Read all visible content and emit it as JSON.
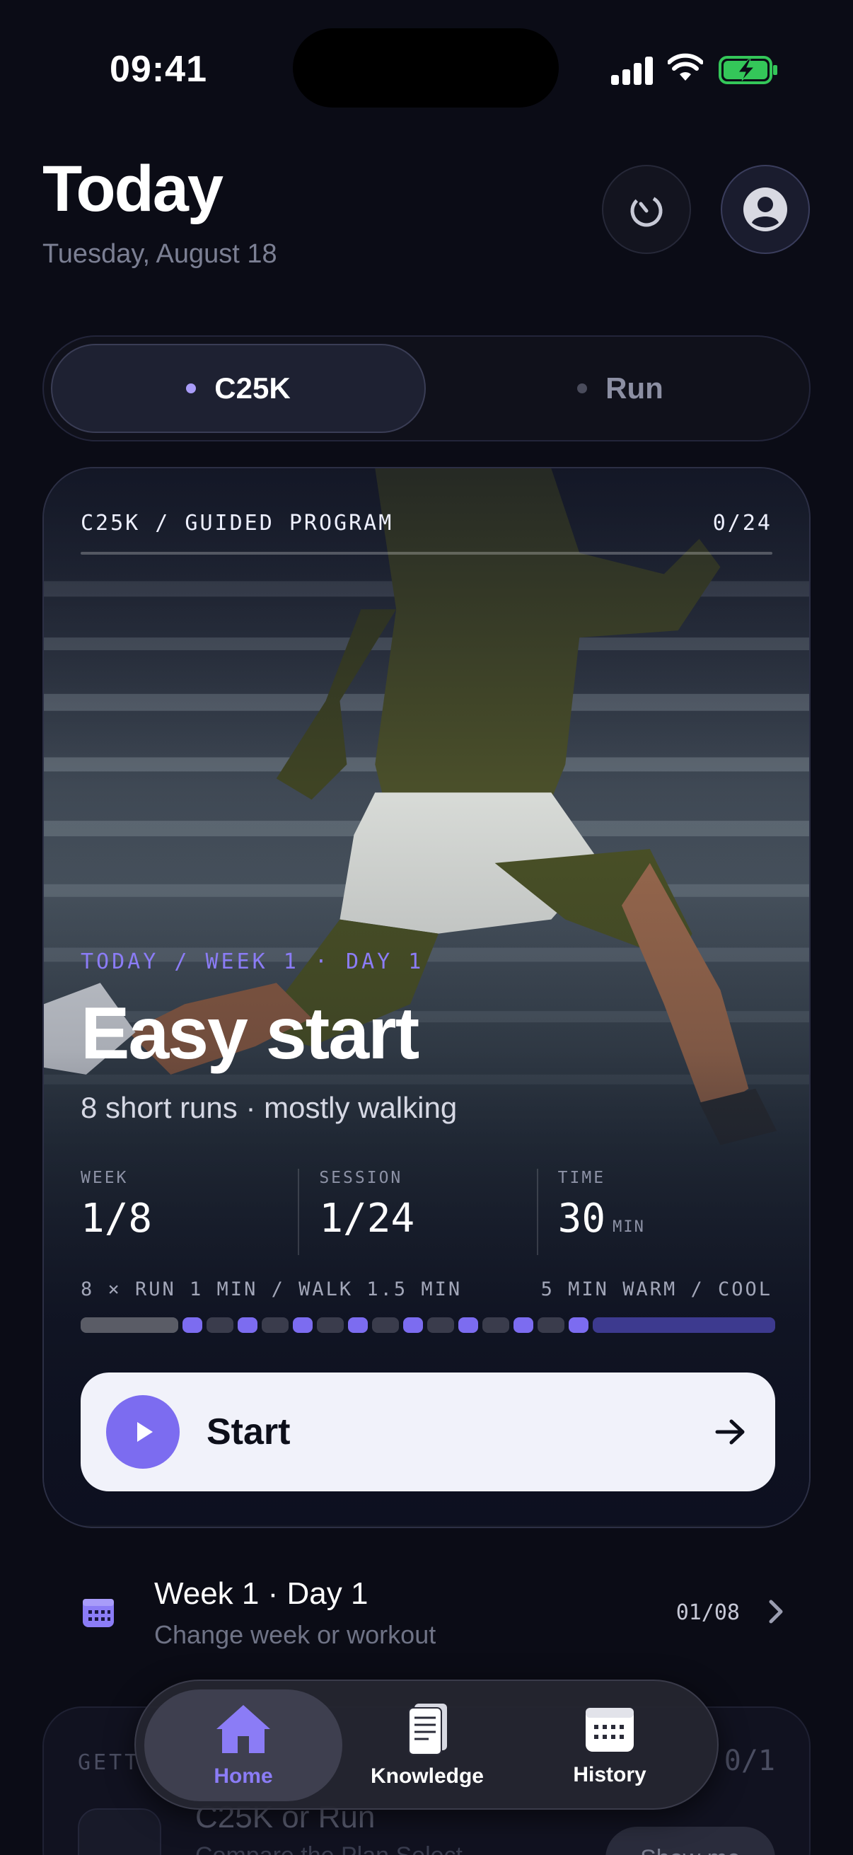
{
  "status_bar": {
    "time": "09:41"
  },
  "header": {
    "title": "Today",
    "date": "Tuesday, August 18"
  },
  "segment": {
    "tabs": [
      "C25K",
      "Run"
    ],
    "selected": "C25K"
  },
  "hero": {
    "program_label": "C25K / GUIDED PROGRAM",
    "progress_count": "0/24",
    "eyebrow": "TODAY / WEEK 1 · DAY 1",
    "title": "Easy start",
    "subtitle": "8 short runs · mostly walking",
    "stats": [
      {
        "label": "WEEK",
        "value": "1/8",
        "unit": ""
      },
      {
        "label": "SESSION",
        "value": "1/24",
        "unit": ""
      },
      {
        "label": "TIME",
        "value": "30",
        "unit": "MIN"
      }
    ],
    "interval_desc": "8 × RUN 1 MIN / WALK 1.5 MIN",
    "warmup_desc": "5 MIN WARM / COOL",
    "start_label": "Start",
    "colors": {
      "accent": "#8b7cf6",
      "run": "#7c6cf0",
      "walk": "#3a3c4c",
      "warm": "#5a5c66",
      "cool": "#3d3a8f"
    }
  },
  "week_row": {
    "title": "Week 1 · Day 1",
    "subtitle": "Change week or workout",
    "count": "01/08"
  },
  "getting_started": {
    "label": "GETT",
    "count": "0/1",
    "title": "C25K or Run",
    "subtitle": "Compare the Plan Select",
    "button": "Show me"
  },
  "tabbar": {
    "tabs": [
      "Home",
      "Knowledge",
      "History"
    ],
    "selected": "Home"
  }
}
